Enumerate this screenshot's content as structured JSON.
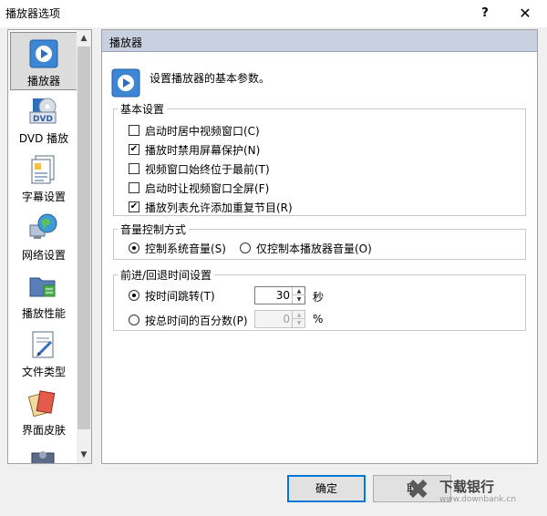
{
  "window": {
    "title": "播放器选项",
    "help_glyph": "?",
    "close_glyph": "✕"
  },
  "nav": {
    "items": [
      {
        "label": "播放器",
        "icon": "player-icon",
        "selected": true
      },
      {
        "label": "DVD 播放",
        "icon": "dvd-icon"
      },
      {
        "label": "字幕设置",
        "icon": "subtitle-icon"
      },
      {
        "label": "网络设置",
        "icon": "network-globe-icon"
      },
      {
        "label": "播放性能",
        "icon": "performance-folder-icon"
      },
      {
        "label": "文件类型",
        "icon": "file-type-icon"
      },
      {
        "label": "界面皮肤",
        "icon": "skin-cards-icon"
      }
    ],
    "scroll_up": "▲",
    "scroll_down": "▼"
  },
  "pane": {
    "header": "播放器",
    "description": "设置播放器的基本参数。",
    "basic": {
      "title": "基本设置",
      "options": [
        {
          "label": "启动时居中视频窗口(C)",
          "checked": false
        },
        {
          "label": "播放时禁用屏幕保护(N)",
          "checked": true
        },
        {
          "label": "视频窗口始终位于最前(T)",
          "checked": false
        },
        {
          "label": "启动时让视频窗口全屏(F)",
          "checked": false
        },
        {
          "label": "播放列表允许添加重复节目(R)",
          "checked": true
        }
      ]
    },
    "volume": {
      "title": "音量控制方式",
      "options": [
        {
          "label": "控制系统音量(S)",
          "selected": true
        },
        {
          "label": "仅控制本播放器音量(O)",
          "selected": false
        }
      ]
    },
    "seek": {
      "title": "前进/回退时间设置",
      "by_time": {
        "label": "按时间跳转(T)",
        "selected": true,
        "value": "30",
        "unit": "秒"
      },
      "by_percent": {
        "label": "按总时间的百分数(P)",
        "selected": false,
        "value": "0",
        "unit": "%"
      }
    }
  },
  "buttons": {
    "ok": "确定",
    "cancel": "取"
  },
  "watermark": {
    "text": "下载银行",
    "url": "www.downbank.cn"
  }
}
